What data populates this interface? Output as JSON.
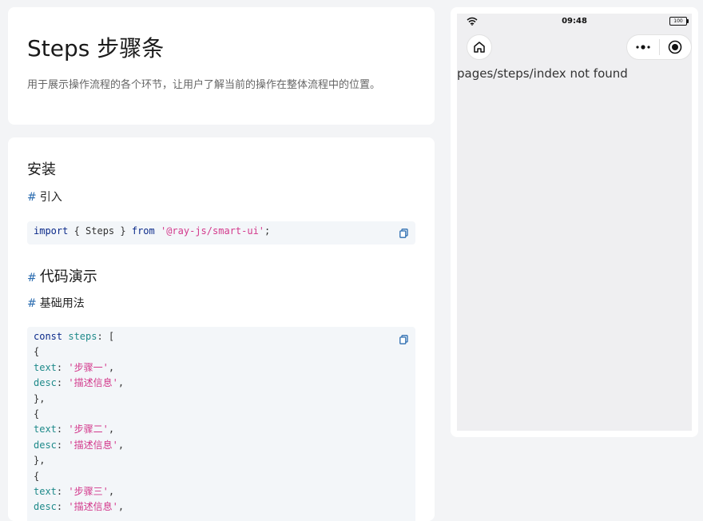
{
  "intro": {
    "title": "Steps 步骤条",
    "description": "用于展示操作流程的各个环节，让用户了解当前的操作在整体流程中的位置。"
  },
  "docs": {
    "install_heading": "安装",
    "import_heading": "引入",
    "hash": "#",
    "import_code": {
      "kw_import": "import",
      "mid": " { Steps } ",
      "kw_from": "from",
      "module": "'@ray-js/smart-ui'",
      "end": ";"
    },
    "demo_heading": "代码演示",
    "basic_heading": "基础用法",
    "demo_code": {
      "kw_const": "const",
      "var_name": "steps",
      "open": ": [",
      "items": [
        {
          "text": "'步骤一'",
          "desc": "'描述信息'"
        },
        {
          "text": "'步骤二'",
          "desc": "'描述信息'"
        },
        {
          "text": "'步骤三'",
          "desc": "'描述信息'"
        }
      ],
      "prop_text": "text",
      "prop_desc": "desc"
    }
  },
  "phone": {
    "time": "09:48",
    "battery": "100",
    "message": "pages/steps/index not found",
    "icons": [
      "wifi-icon",
      "battery-icon",
      "home-icon",
      "more-icon",
      "record-icon",
      "copy-icon"
    ]
  }
}
